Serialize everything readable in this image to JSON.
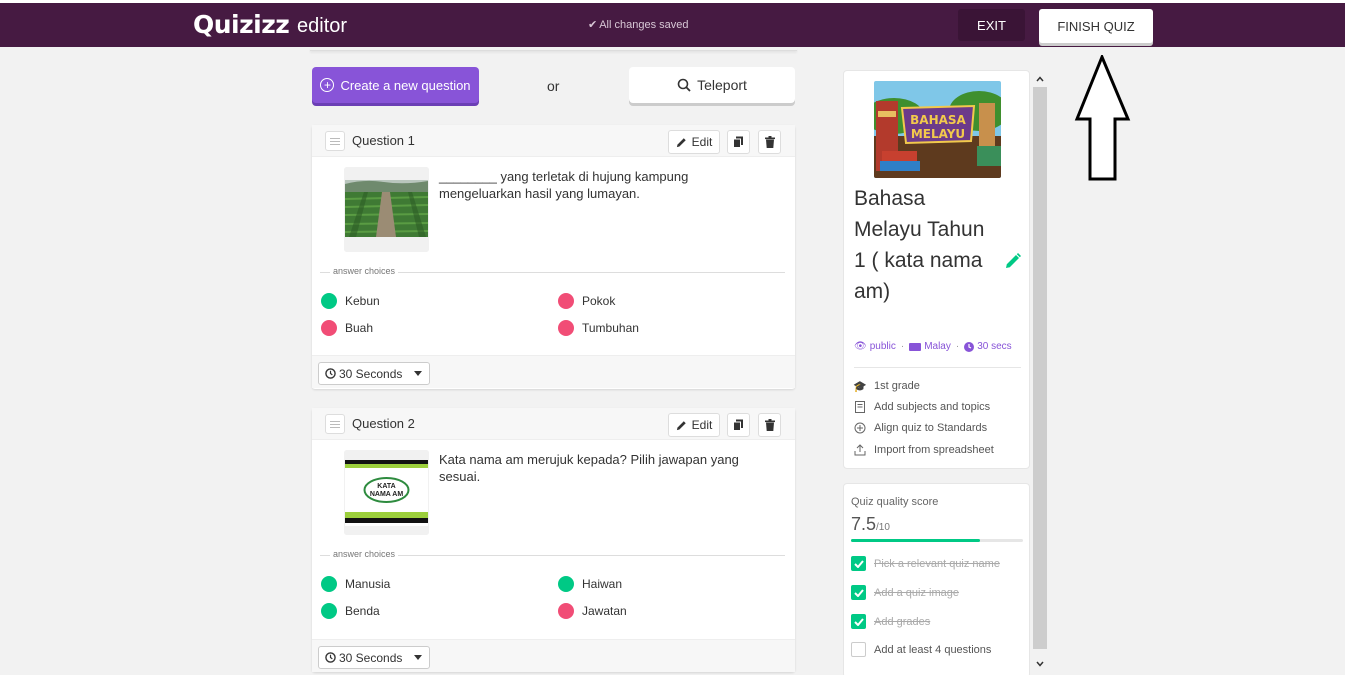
{
  "header": {
    "logo": "Quizizz",
    "subtitle": "editor",
    "save_status": "All changes saved",
    "exit_label": "EXIT",
    "finish_label": "FINISH QUIZ",
    "bg_color": "#461a42"
  },
  "toolbar": {
    "create_label": "Create a new question",
    "or_label": "or",
    "teleport_label": "Teleport"
  },
  "questions": [
    {
      "title": "Question 1",
      "edit_label": "Edit",
      "text": "________ yang terletak di hujung kampung mengeluarkan hasil yang lumayan.",
      "choices_label": "answer choices",
      "choices": [
        {
          "label": "Kebun",
          "correct": true
        },
        {
          "label": "Pokok",
          "correct": false
        },
        {
          "label": "Buah",
          "correct": false
        },
        {
          "label": "Tumbuhan",
          "correct": false
        }
      ],
      "time": "30 Seconds"
    },
    {
      "title": "Question 2",
      "edit_label": "Edit",
      "text": "Kata nama am merujuk kepada? Pilih jawapan yang sesuai.",
      "image_text": "KATA NAMA AM",
      "choices_label": "answer choices",
      "choices": [
        {
          "label": "Manusia",
          "correct": true
        },
        {
          "label": "Haiwan",
          "correct": true
        },
        {
          "label": "Benda",
          "correct": true
        },
        {
          "label": "Jawatan",
          "correct": false
        }
      ],
      "time": "30 Seconds"
    }
  ],
  "quiz_panel": {
    "cover_text_1": "BAHASA",
    "cover_text_2": "MELAYU",
    "title": "Bahasa Melayu Tahun 1 ( kata nama am)",
    "visibility": "public",
    "language": "Malay",
    "duration": "30 secs",
    "grade": "1st grade",
    "subjects_link": "Add subjects and topics",
    "standards_link": "Align quiz to Standards",
    "import_link": "Import from spreadsheet"
  },
  "quality": {
    "label": "Quiz quality score",
    "score": "7.5",
    "out_of": "/10",
    "score_fraction": 0.75,
    "checks": [
      {
        "label": "Pick a relevant quiz name",
        "done": true
      },
      {
        "label": "Add a quiz image",
        "done": true
      },
      {
        "label": "Add grades",
        "done": true
      },
      {
        "label": "Add at least 4 questions",
        "done": false
      }
    ]
  },
  "colors": {
    "accent": "#8854d8",
    "correct": "#00c985",
    "incorrect": "#f14d76"
  }
}
